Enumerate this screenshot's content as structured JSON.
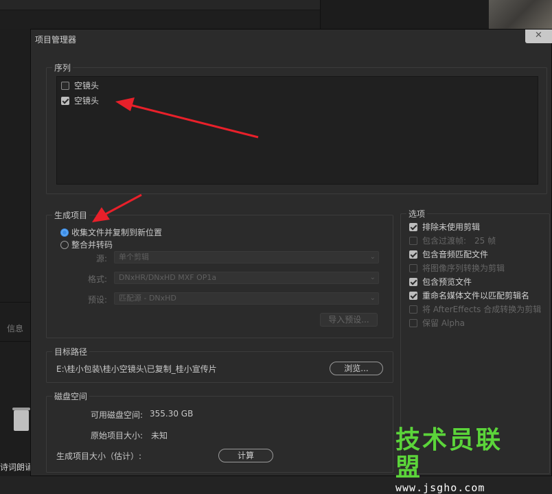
{
  "background": {
    "left_tab": "信息",
    "bottom_text": "诗词朗诵"
  },
  "dialog": {
    "title": "项目管理器",
    "close": "✕"
  },
  "sequence": {
    "legend": "序列",
    "items": [
      {
        "label": "空镜头",
        "checked": false
      },
      {
        "label": "空镜头",
        "checked": true
      }
    ]
  },
  "resulting_project": {
    "legend": "生成项目",
    "radio_collect": "收集文件并复制到新位置",
    "radio_consolidate": "整合并转码",
    "source_label": "源:",
    "source_value": "单个剪辑",
    "format_label": "格式:",
    "format_value": "DNxHR/DNxHD MXF OP1a",
    "preset_label": "预设:",
    "preset_value": "匹配源 - DNxHD",
    "import_preset": "导入预设..."
  },
  "destination": {
    "legend": "目标路径",
    "path": "E:\\桂小包装\\桂小空镜头\\已复制_桂小宣传片",
    "browse": "浏览..."
  },
  "disk_space": {
    "legend": "磁盘空间",
    "available_label": "可用磁盘空间:",
    "available_value": "355.30 GB",
    "original_label": "原始项目大小:",
    "original_value": "未知",
    "resulting_label": "生成项目大小（估计）:",
    "calculate": "计算"
  },
  "options": {
    "legend": "选项",
    "items": [
      {
        "label": "排除未使用剪辑",
        "checked": true,
        "disabled": false
      },
      {
        "label": "包含过渡帧:",
        "extra": "25 帧",
        "checked": false,
        "disabled": true
      },
      {
        "label": "包含音频匹配文件",
        "checked": true,
        "disabled": false
      },
      {
        "label": "将图像序列转换为剪辑",
        "checked": false,
        "disabled": true
      },
      {
        "label": "包含预览文件",
        "checked": true,
        "disabled": false
      },
      {
        "label": "重命名媒体文件以匹配剪辑名",
        "checked": true,
        "disabled": false
      },
      {
        "label": "将 AfterEffects 合成转换为剪辑",
        "checked": false,
        "disabled": true
      },
      {
        "label": "保留 Alpha",
        "checked": false,
        "disabled": true
      }
    ]
  },
  "watermark": {
    "main": "技术员联盟",
    "url": "www.jsgho.com"
  },
  "colors": {
    "accent_radio": "#3b8eea",
    "arrow": "#e8202a",
    "watermark_green": "#5bd43a"
  }
}
